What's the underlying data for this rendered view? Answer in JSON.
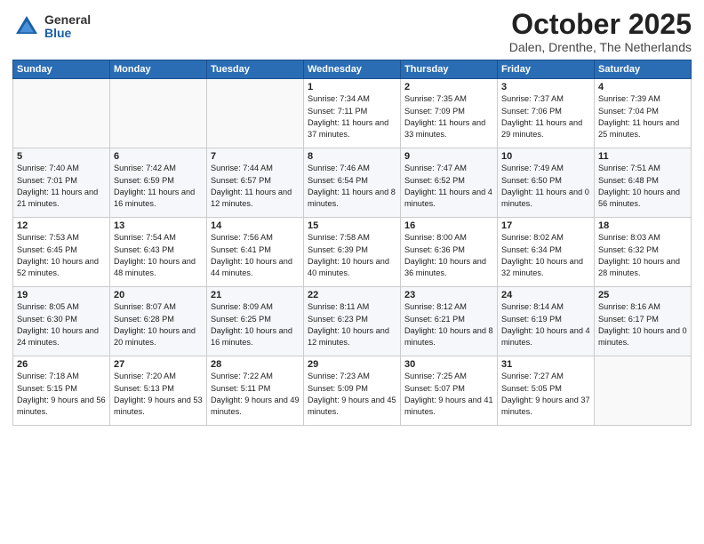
{
  "header": {
    "logo_general": "General",
    "logo_blue": "Blue",
    "title": "October 2025",
    "location": "Dalen, Drenthe, The Netherlands"
  },
  "days_of_week": [
    "Sunday",
    "Monday",
    "Tuesday",
    "Wednesday",
    "Thursday",
    "Friday",
    "Saturday"
  ],
  "weeks": [
    [
      {
        "day": "",
        "sunrise": "",
        "sunset": "",
        "daylight": ""
      },
      {
        "day": "",
        "sunrise": "",
        "sunset": "",
        "daylight": ""
      },
      {
        "day": "",
        "sunrise": "",
        "sunset": "",
        "daylight": ""
      },
      {
        "day": "1",
        "sunrise": "Sunrise: 7:34 AM",
        "sunset": "Sunset: 7:11 PM",
        "daylight": "Daylight: 11 hours and 37 minutes."
      },
      {
        "day": "2",
        "sunrise": "Sunrise: 7:35 AM",
        "sunset": "Sunset: 7:09 PM",
        "daylight": "Daylight: 11 hours and 33 minutes."
      },
      {
        "day": "3",
        "sunrise": "Sunrise: 7:37 AM",
        "sunset": "Sunset: 7:06 PM",
        "daylight": "Daylight: 11 hours and 29 minutes."
      },
      {
        "day": "4",
        "sunrise": "Sunrise: 7:39 AM",
        "sunset": "Sunset: 7:04 PM",
        "daylight": "Daylight: 11 hours and 25 minutes."
      }
    ],
    [
      {
        "day": "5",
        "sunrise": "Sunrise: 7:40 AM",
        "sunset": "Sunset: 7:01 PM",
        "daylight": "Daylight: 11 hours and 21 minutes."
      },
      {
        "day": "6",
        "sunrise": "Sunrise: 7:42 AM",
        "sunset": "Sunset: 6:59 PM",
        "daylight": "Daylight: 11 hours and 16 minutes."
      },
      {
        "day": "7",
        "sunrise": "Sunrise: 7:44 AM",
        "sunset": "Sunset: 6:57 PM",
        "daylight": "Daylight: 11 hours and 12 minutes."
      },
      {
        "day": "8",
        "sunrise": "Sunrise: 7:46 AM",
        "sunset": "Sunset: 6:54 PM",
        "daylight": "Daylight: 11 hours and 8 minutes."
      },
      {
        "day": "9",
        "sunrise": "Sunrise: 7:47 AM",
        "sunset": "Sunset: 6:52 PM",
        "daylight": "Daylight: 11 hours and 4 minutes."
      },
      {
        "day": "10",
        "sunrise": "Sunrise: 7:49 AM",
        "sunset": "Sunset: 6:50 PM",
        "daylight": "Daylight: 11 hours and 0 minutes."
      },
      {
        "day": "11",
        "sunrise": "Sunrise: 7:51 AM",
        "sunset": "Sunset: 6:48 PM",
        "daylight": "Daylight: 10 hours and 56 minutes."
      }
    ],
    [
      {
        "day": "12",
        "sunrise": "Sunrise: 7:53 AM",
        "sunset": "Sunset: 6:45 PM",
        "daylight": "Daylight: 10 hours and 52 minutes."
      },
      {
        "day": "13",
        "sunrise": "Sunrise: 7:54 AM",
        "sunset": "Sunset: 6:43 PM",
        "daylight": "Daylight: 10 hours and 48 minutes."
      },
      {
        "day": "14",
        "sunrise": "Sunrise: 7:56 AM",
        "sunset": "Sunset: 6:41 PM",
        "daylight": "Daylight: 10 hours and 44 minutes."
      },
      {
        "day": "15",
        "sunrise": "Sunrise: 7:58 AM",
        "sunset": "Sunset: 6:39 PM",
        "daylight": "Daylight: 10 hours and 40 minutes."
      },
      {
        "day": "16",
        "sunrise": "Sunrise: 8:00 AM",
        "sunset": "Sunset: 6:36 PM",
        "daylight": "Daylight: 10 hours and 36 minutes."
      },
      {
        "day": "17",
        "sunrise": "Sunrise: 8:02 AM",
        "sunset": "Sunset: 6:34 PM",
        "daylight": "Daylight: 10 hours and 32 minutes."
      },
      {
        "day": "18",
        "sunrise": "Sunrise: 8:03 AM",
        "sunset": "Sunset: 6:32 PM",
        "daylight": "Daylight: 10 hours and 28 minutes."
      }
    ],
    [
      {
        "day": "19",
        "sunrise": "Sunrise: 8:05 AM",
        "sunset": "Sunset: 6:30 PM",
        "daylight": "Daylight: 10 hours and 24 minutes."
      },
      {
        "day": "20",
        "sunrise": "Sunrise: 8:07 AM",
        "sunset": "Sunset: 6:28 PM",
        "daylight": "Daylight: 10 hours and 20 minutes."
      },
      {
        "day": "21",
        "sunrise": "Sunrise: 8:09 AM",
        "sunset": "Sunset: 6:25 PM",
        "daylight": "Daylight: 10 hours and 16 minutes."
      },
      {
        "day": "22",
        "sunrise": "Sunrise: 8:11 AM",
        "sunset": "Sunset: 6:23 PM",
        "daylight": "Daylight: 10 hours and 12 minutes."
      },
      {
        "day": "23",
        "sunrise": "Sunrise: 8:12 AM",
        "sunset": "Sunset: 6:21 PM",
        "daylight": "Daylight: 10 hours and 8 minutes."
      },
      {
        "day": "24",
        "sunrise": "Sunrise: 8:14 AM",
        "sunset": "Sunset: 6:19 PM",
        "daylight": "Daylight: 10 hours and 4 minutes."
      },
      {
        "day": "25",
        "sunrise": "Sunrise: 8:16 AM",
        "sunset": "Sunset: 6:17 PM",
        "daylight": "Daylight: 10 hours and 0 minutes."
      }
    ],
    [
      {
        "day": "26",
        "sunrise": "Sunrise: 7:18 AM",
        "sunset": "Sunset: 5:15 PM",
        "daylight": "Daylight: 9 hours and 56 minutes."
      },
      {
        "day": "27",
        "sunrise": "Sunrise: 7:20 AM",
        "sunset": "Sunset: 5:13 PM",
        "daylight": "Daylight: 9 hours and 53 minutes."
      },
      {
        "day": "28",
        "sunrise": "Sunrise: 7:22 AM",
        "sunset": "Sunset: 5:11 PM",
        "daylight": "Daylight: 9 hours and 49 minutes."
      },
      {
        "day": "29",
        "sunrise": "Sunrise: 7:23 AM",
        "sunset": "Sunset: 5:09 PM",
        "daylight": "Daylight: 9 hours and 45 minutes."
      },
      {
        "day": "30",
        "sunrise": "Sunrise: 7:25 AM",
        "sunset": "Sunset: 5:07 PM",
        "daylight": "Daylight: 9 hours and 41 minutes."
      },
      {
        "day": "31",
        "sunrise": "Sunrise: 7:27 AM",
        "sunset": "Sunset: 5:05 PM",
        "daylight": "Daylight: 9 hours and 37 minutes."
      },
      {
        "day": "",
        "sunrise": "",
        "sunset": "",
        "daylight": ""
      }
    ]
  ]
}
